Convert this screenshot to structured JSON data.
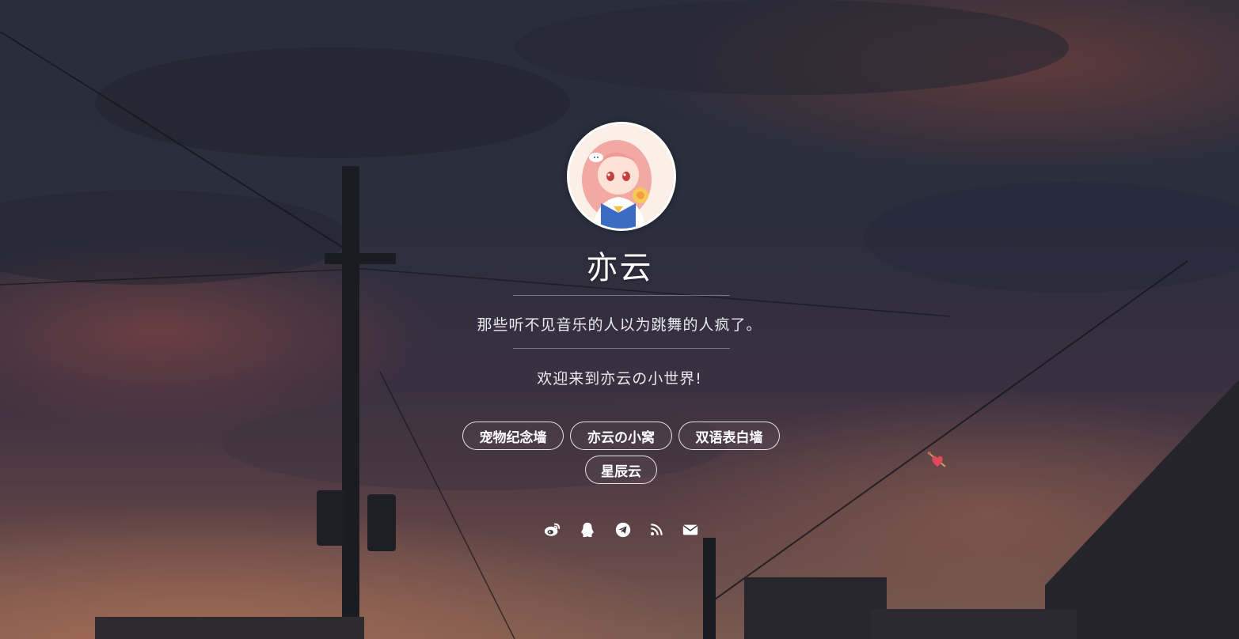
{
  "profile": {
    "name": "亦云",
    "motto": "那些听不见音乐的人以为跳舞的人疯了。",
    "welcome": "欢迎来到亦云の小世界!"
  },
  "links": [
    {
      "label": "宠物纪念墙"
    },
    {
      "label": "亦云の小窝"
    },
    {
      "label": "双语表白墙"
    },
    {
      "label": "星辰云"
    }
  ],
  "social_icons": [
    "weibo-icon",
    "qq-icon",
    "telegram-icon",
    "rss-icon",
    "email-icon"
  ],
  "colors": {
    "text": "#ffffff",
    "subtext": "#e9e9ee",
    "avatar_hair": "#f0a4a0"
  }
}
